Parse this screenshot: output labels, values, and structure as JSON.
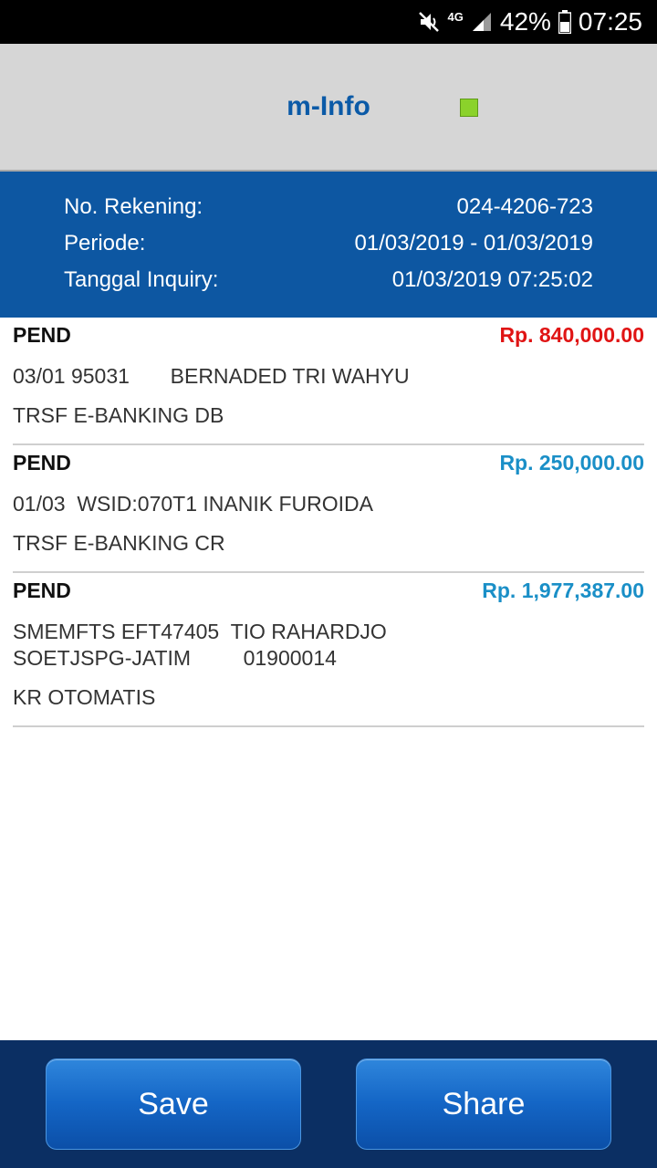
{
  "status_bar": {
    "network": "4G",
    "battery": "42%",
    "time": "07:25",
    "icons": [
      "mute-icon",
      "signal-icon",
      "battery-icon"
    ]
  },
  "header": {
    "title": "m-Info",
    "indicator_color": "#8bd22b"
  },
  "info": {
    "account_label": "No. Rekening:",
    "account_value": "024-4206-723",
    "period_label": "Periode:",
    "period_value": "01/03/2019 - 01/03/2019",
    "inquiry_label": "Tanggal Inquiry:",
    "inquiry_value": "01/03/2019 07:25:02"
  },
  "transactions": [
    {
      "status": "PEND",
      "amount": "Rp. 840,000.00",
      "amount_color": "#e01414",
      "description": "03/01 95031       BERNADED TRI WAHYU",
      "type": "TRSF E-BANKING DB"
    },
    {
      "status": "PEND",
      "amount": "Rp. 250,000.00",
      "amount_color": "#1a8fc7",
      "description": "01/03  WSID:070T1 INANIK FUROIDA",
      "type": "TRSF E-BANKING CR"
    },
    {
      "status": "PEND",
      "amount": "Rp. 1,977,387.00",
      "amount_color": "#1a8fc7",
      "description": "SMEMFTS EFT47405  TIO RAHARDJO\nSOETJSPG-JATIM         01900014",
      "type": "KR OTOMATIS"
    }
  ],
  "actions": {
    "save_label": "Save",
    "share_label": "Share"
  },
  "colors": {
    "brand_blue": "#0d57a2",
    "bottom_bar": "#0b2f63",
    "header_bg": "#d6d6d6"
  }
}
